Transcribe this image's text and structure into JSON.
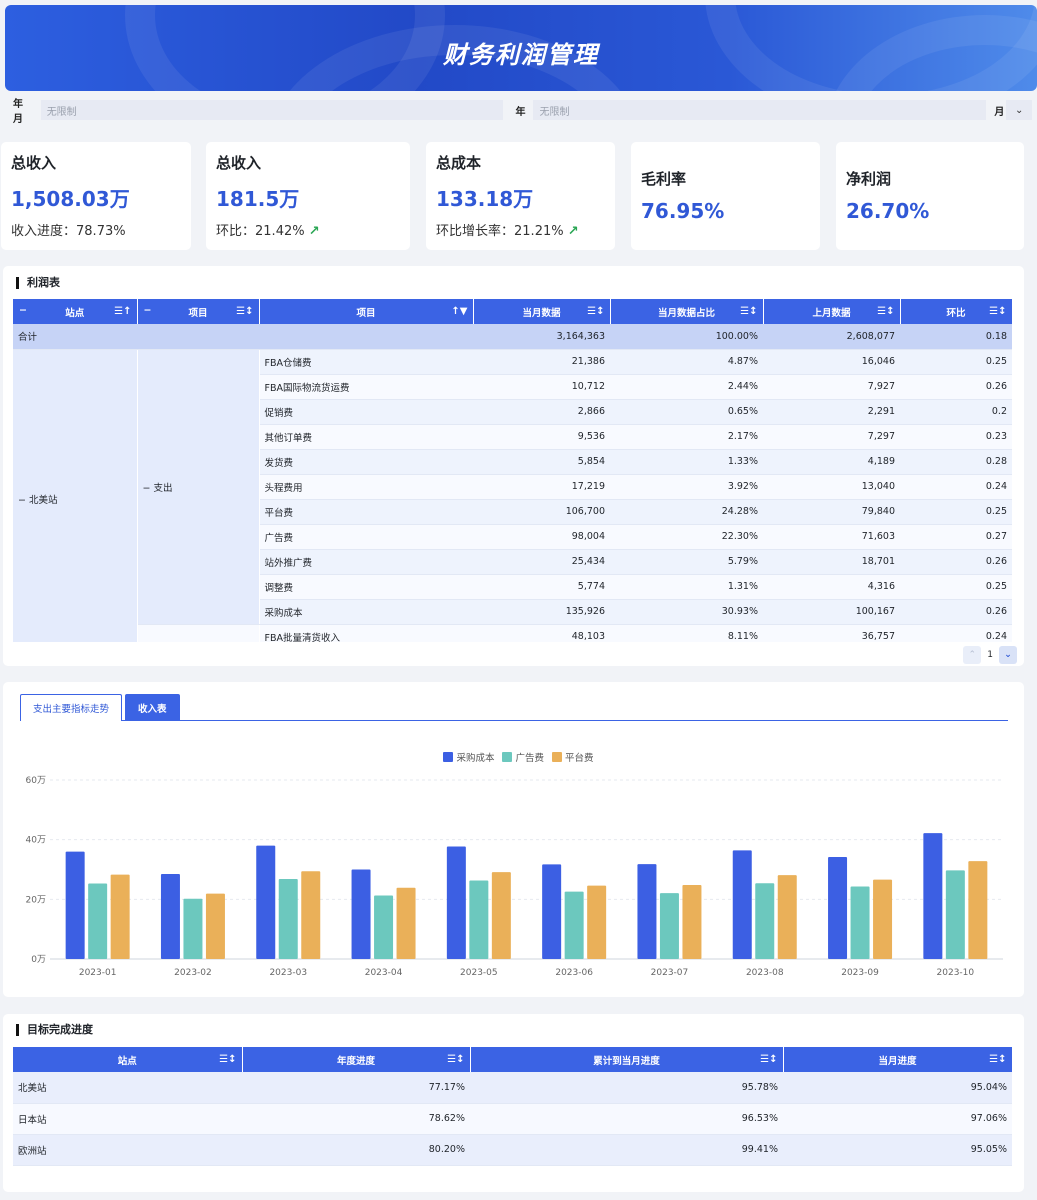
{
  "header": {
    "title": "财务利润管理"
  },
  "filters": {
    "year_month_label": "年月",
    "year_month_value": "无限制",
    "year_label": "年",
    "year_value": "无限制",
    "month_label": "月"
  },
  "kpis": [
    {
      "title": "总收入",
      "value": "1,508.03万",
      "sub_label": "收入进度：",
      "sub_value": "78.73%"
    },
    {
      "title": "总收入",
      "value": "181.5万",
      "sub_label": "环比：",
      "sub_value": "21.42%"
    },
    {
      "title": "总成本",
      "value": "133.18万",
      "sub_label": "环比增长率：",
      "sub_value": "21.21%"
    },
    {
      "title": "毛利率",
      "value": "76.95%"
    },
    {
      "title": "净利润",
      "value": "26.70%"
    }
  ],
  "profit_table": {
    "title": "利润表",
    "headers": [
      "站点",
      "项目",
      "项目",
      "当月数据",
      "当月数据占比",
      "上月数据",
      "环比"
    ],
    "total": {
      "label": "合计",
      "current": "3,164,363",
      "ratio": "100.00%",
      "last": "2,608,077",
      "mom": "0.18"
    },
    "site": "北美站",
    "group": "支出",
    "rows": [
      {
        "item": "FBA仓储费",
        "current": "21,386",
        "ratio": "4.87%",
        "last": "16,046",
        "mom": "0.25"
      },
      {
        "item": "FBA国际物流货运费",
        "current": "10,712",
        "ratio": "2.44%",
        "last": "7,927",
        "mom": "0.26"
      },
      {
        "item": "促销费",
        "current": "2,866",
        "ratio": "0.65%",
        "last": "2,291",
        "mom": "0.2"
      },
      {
        "item": "其他订单费",
        "current": "9,536",
        "ratio": "2.17%",
        "last": "7,297",
        "mom": "0.23"
      },
      {
        "item": "发货费",
        "current": "5,854",
        "ratio": "1.33%",
        "last": "4,189",
        "mom": "0.28"
      },
      {
        "item": "头程费用",
        "current": "17,219",
        "ratio": "3.92%",
        "last": "13,040",
        "mom": "0.24"
      },
      {
        "item": "平台费",
        "current": "106,700",
        "ratio": "24.28%",
        "last": "79,840",
        "mom": "0.25"
      },
      {
        "item": "广告费",
        "current": "98,004",
        "ratio": "22.30%",
        "last": "71,603",
        "mom": "0.27"
      },
      {
        "item": "站外推广费",
        "current": "25,434",
        "ratio": "5.79%",
        "last": "18,701",
        "mom": "0.26"
      },
      {
        "item": "调整费",
        "current": "5,774",
        "ratio": "1.31%",
        "last": "4,316",
        "mom": "0.25"
      },
      {
        "item": "采购成本",
        "current": "135,926",
        "ratio": "30.93%",
        "last": "100,167",
        "mom": "0.26"
      }
    ],
    "extra_row": {
      "item": "FBA批量清货收入",
      "current": "48,103",
      "ratio": "8.11%",
      "last": "36,757",
      "mom": "0.24"
    },
    "page": "1"
  },
  "tabs": [
    {
      "label": "支出主要指标走势",
      "active": false
    },
    {
      "label": "收入表",
      "active": true
    }
  ],
  "chart_data": {
    "type": "bar",
    "categories": [
      "2023-01",
      "2023-02",
      "2023-03",
      "2023-04",
      "2023-05",
      "2023-06",
      "2023-07",
      "2023-08",
      "2023-09",
      "2023-10"
    ],
    "series": [
      {
        "name": "采购成本",
        "color": "#3c5fe3",
        "values": [
          36,
          28.5,
          38,
          30,
          37.7,
          31.7,
          31.8,
          36.4,
          34.2,
          42.2
        ]
      },
      {
        "name": "广告费",
        "color": "#6cc8be",
        "values": [
          25.3,
          20.2,
          26.8,
          21.3,
          26.3,
          22.6,
          22.1,
          25.4,
          24.3,
          29.7
        ]
      },
      {
        "name": "平台费",
        "color": "#eab059",
        "values": [
          28.3,
          21.9,
          29.4,
          23.9,
          29.1,
          24.6,
          24.8,
          28.1,
          26.6,
          32.8
        ]
      }
    ],
    "yticks": [
      "0万",
      "20万",
      "40万",
      "60万"
    ],
    "ylim": [
      0,
      60
    ],
    "legend_position": "top-center"
  },
  "target_table": {
    "title": "目标完成进度",
    "headers": [
      "站点",
      "年度进度",
      "累计到当月进度",
      "当月进度"
    ],
    "rows": [
      {
        "site": "北美站",
        "annual": "77.17%",
        "cumulative": "95.78%",
        "month": "95.04%"
      },
      {
        "site": "日本站",
        "annual": "78.62%",
        "cumulative": "96.53%",
        "month": "97.06%"
      },
      {
        "site": "欧洲站",
        "annual": "80.20%",
        "cumulative": "99.41%",
        "month": "95.05%"
      }
    ]
  }
}
